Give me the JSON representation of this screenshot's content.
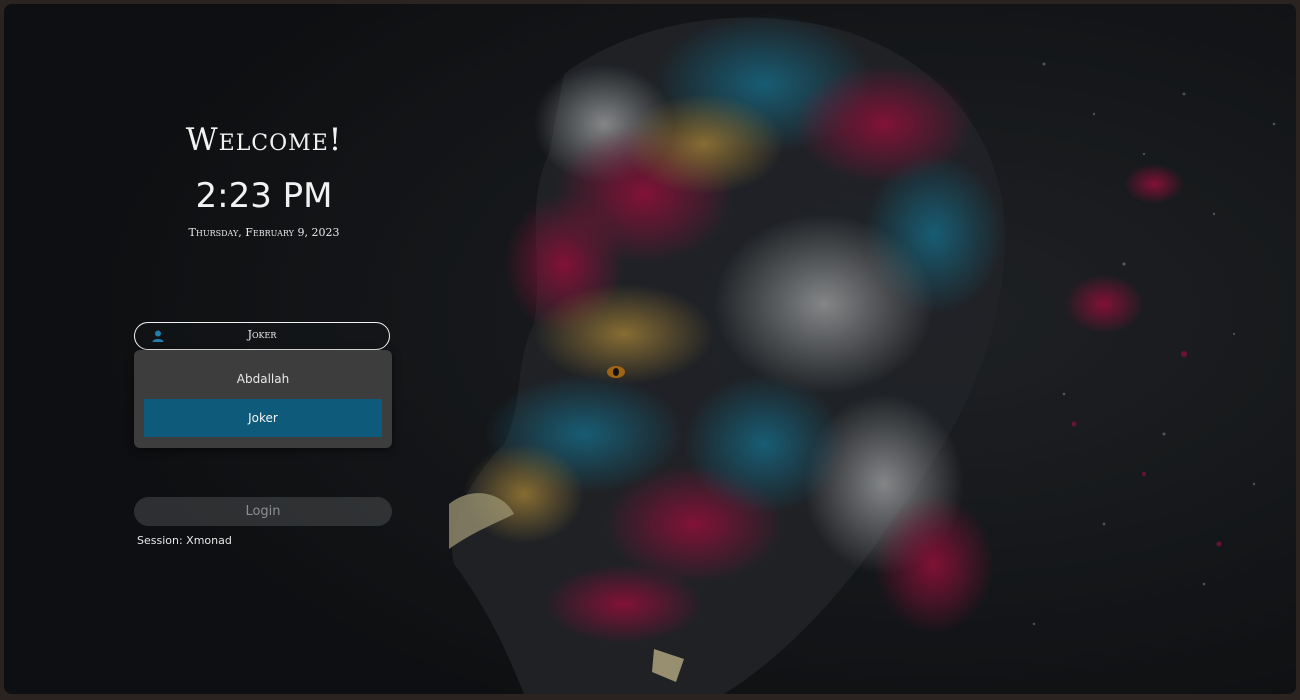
{
  "greeting": {
    "title": "Welcome!",
    "time": "2:23 PM",
    "date": "Thursday, February 9, 2023"
  },
  "user_select": {
    "selected": "Joker",
    "icon": "user-icon",
    "options": [
      "Abdallah",
      "Joker"
    ],
    "highlighted_index": 1
  },
  "login": {
    "label": "Login"
  },
  "session": {
    "prefix": "Session:",
    "name": "Xmonad",
    "text": "Session: Xmonad"
  },
  "colors": {
    "highlight": "#0e5a7a",
    "background": "#17191c",
    "dropdown": "#3d3d3d",
    "accent_magenta": "#c3174f",
    "accent_cyan": "#1f8fb3",
    "accent_gold": "#d4a94a"
  }
}
